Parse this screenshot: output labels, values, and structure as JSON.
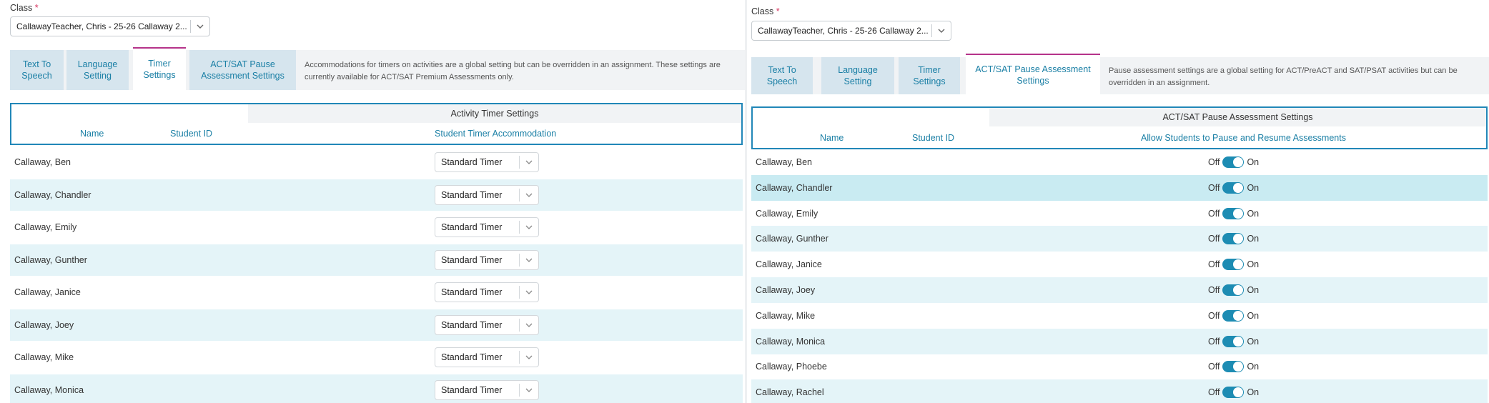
{
  "left": {
    "class_label": "Class",
    "required_mark": "*",
    "class_value": "CallawayTeacher, Chris - 25-26 Callaway 2...",
    "tabs": [
      {
        "label": "Text To Speech"
      },
      {
        "label": "Language Setting"
      },
      {
        "label": "Timer Settings"
      },
      {
        "label": "ACT/SAT Pause Assessment Settings"
      }
    ],
    "active_tab": "Timer Settings",
    "description": "Accommodations for timers on activities are a global setting but can be overridden in an assignment. These settings are currently available for ACT/SAT Premium Assessments only.",
    "group_header": "Activity Timer Settings",
    "col_name": "Name",
    "col_student_id": "Student ID",
    "col_setting": "Student Timer Accommodation",
    "rows": [
      {
        "name": "Callaway, Ben",
        "value": "Standard Timer"
      },
      {
        "name": "Callaway, Chandler",
        "value": "Standard Timer"
      },
      {
        "name": "Callaway, Emily",
        "value": "Standard Timer"
      },
      {
        "name": "Callaway, Gunther",
        "value": "Standard Timer"
      },
      {
        "name": "Callaway, Janice",
        "value": "Standard Timer"
      },
      {
        "name": "Callaway, Joey",
        "value": "Standard Timer"
      },
      {
        "name": "Callaway, Mike",
        "value": "Standard Timer"
      },
      {
        "name": "Callaway, Monica",
        "value": "Standard Timer"
      }
    ]
  },
  "right": {
    "class_label": "Class",
    "required_mark": "*",
    "class_value": "CallawayTeacher, Chris - 25-26 Callaway 2...",
    "tabs": [
      {
        "label": "Text To Speech"
      },
      {
        "label": "Language Setting"
      },
      {
        "label": "Timer Settings"
      },
      {
        "label": "ACT/SAT Pause Assessment Settings"
      }
    ],
    "active_tab": "ACT/SAT Pause Assessment Settings",
    "description": "Pause assessment settings are a global setting for ACT/PreACT and SAT/PSAT activities but can be overridden in an assignment.",
    "group_header": "ACT/SAT Pause Assessment Settings",
    "col_name": "Name",
    "col_student_id": "Student ID",
    "col_setting": "Allow Students to Pause and Resume Assessments",
    "off_label": "Off",
    "on_label": "On",
    "rows": [
      {
        "name": "Callaway, Ben",
        "on": true
      },
      {
        "name": "Callaway, Chandler",
        "on": true
      },
      {
        "name": "Callaway, Emily",
        "on": true
      },
      {
        "name": "Callaway, Gunther",
        "on": true
      },
      {
        "name": "Callaway, Janice",
        "on": true
      },
      {
        "name": "Callaway, Joey",
        "on": true
      },
      {
        "name": "Callaway, Mike",
        "on": true
      },
      {
        "name": "Callaway, Monica",
        "on": true
      },
      {
        "name": "Callaway, Phoebe",
        "on": true
      },
      {
        "name": "Callaway, Rachel",
        "on": true
      }
    ]
  },
  "colors": {
    "accent": "#1a7fa5",
    "active_tab_border": "#b5338a",
    "required": "#d6335e",
    "toggle_on": "#1d8cb3",
    "row_alt": "#e4f4f8"
  }
}
